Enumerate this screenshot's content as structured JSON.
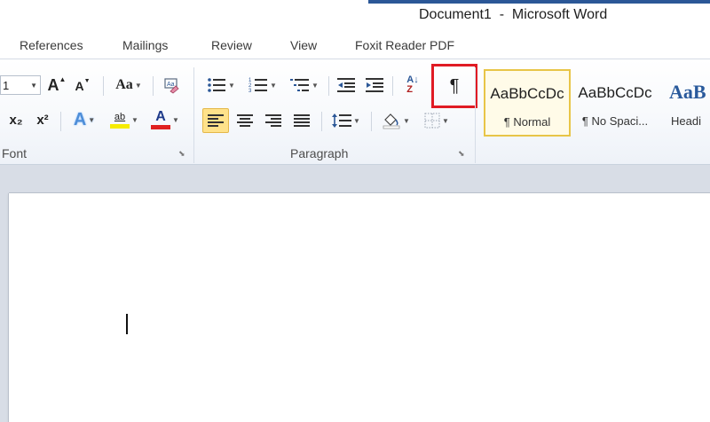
{
  "window": {
    "title": "Document1  -  Microsoft Word"
  },
  "tabs": [
    "References",
    "Mailings",
    "Review",
    "View",
    "Foxit Reader PDF"
  ],
  "font_group": {
    "label": "Font",
    "font_size_value": "1",
    "grow_font_glyph": "A",
    "shrink_font_glyph": "A",
    "change_case_label": "Aa",
    "subscript_label": "x₂",
    "superscript_label": "x²",
    "text_effects_glyph": "A",
    "highlight_glyph": "ab",
    "font_color_glyph": "A",
    "highlight_color": "#f6ec00",
    "font_color": "#e02020"
  },
  "paragraph_group": {
    "label": "Paragraph",
    "pilcrow_glyph": "¶",
    "sort_glyph": "A↓",
    "sort_glyph_z": "Z"
  },
  "styles": [
    {
      "preview": "AaBbCcDc",
      "name": "¶ Normal",
      "selected": true
    },
    {
      "preview": "AaBbCcDc",
      "name": "¶ No Spaci...",
      "selected": false
    },
    {
      "preview": "AaB",
      "name": "Headi",
      "selected": false
    }
  ],
  "colors": {
    "accent": "#2b5797",
    "highlight_frame": "#e01b24",
    "active_button": "#ffe28a",
    "heading_blue": "#2a5a9c"
  }
}
